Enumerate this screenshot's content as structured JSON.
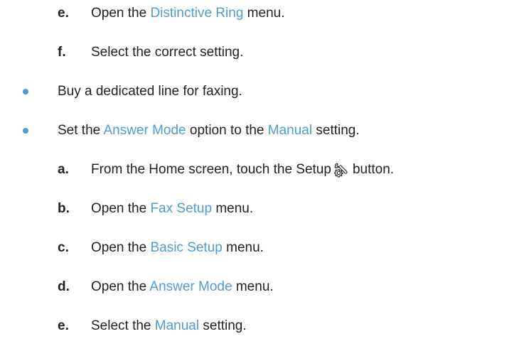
{
  "steps_top": [
    {
      "letter": "e.",
      "before": "Open the ",
      "highlight": "Distinctive Ring",
      "after": " menu."
    },
    {
      "letter": "f.",
      "text": "Select the correct setting."
    }
  ],
  "bullets": [
    {
      "text": "Buy a dedicated line for faxing."
    },
    {
      "part1": "Set the ",
      "highlight1": "Answer Mode",
      "part2": " option to the ",
      "highlight2": "Manual",
      "part3": " setting."
    }
  ],
  "steps_bottom": [
    {
      "letter": "a.",
      "before": "From the Home screen, touch the Setup",
      "icon": "setup-wrench-gear-icon",
      "after": "button."
    },
    {
      "letter": "b.",
      "before": "Open the ",
      "highlight": "Fax Setup",
      "after": " menu."
    },
    {
      "letter": "c.",
      "before": "Open the ",
      "highlight": "Basic Setup",
      "after": " menu."
    },
    {
      "letter": "d.",
      "before": "Open the ",
      "highlight": "Answer Mode",
      "after": " menu."
    },
    {
      "letter": "e.",
      "before": "Select the ",
      "highlight": "Manual",
      "after": " setting."
    }
  ],
  "colors": {
    "text": "#231f20",
    "highlight": "#4f9bd3",
    "bullet": "#4f9bd3"
  }
}
